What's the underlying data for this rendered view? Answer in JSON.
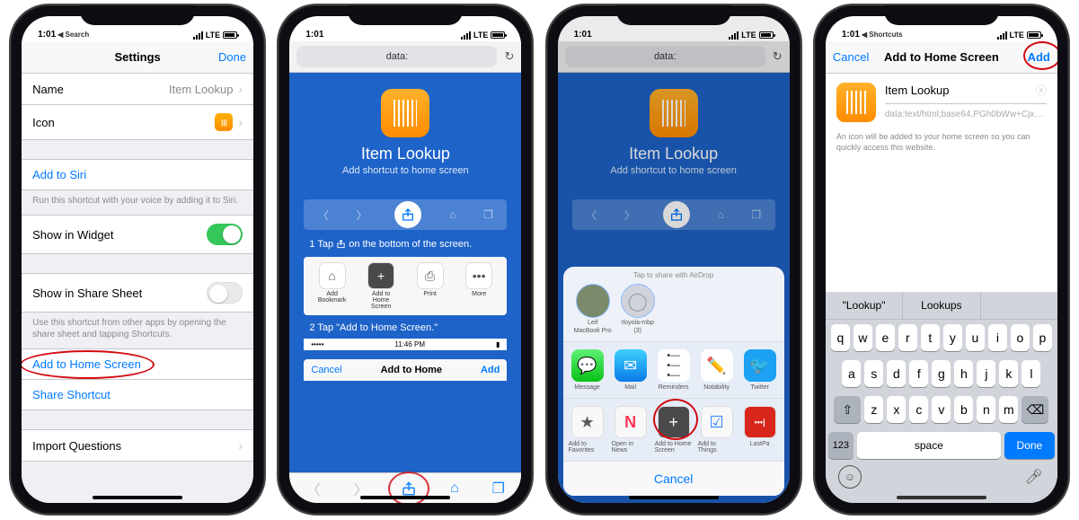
{
  "status": {
    "time": "1:01",
    "back_search": "Search",
    "back_shortcuts": "Shortcuts",
    "carrier": "LTE"
  },
  "p1": {
    "nav": {
      "title": "Settings",
      "done": "Done"
    },
    "name": {
      "label": "Name",
      "value": "Item Lookup"
    },
    "icon": {
      "label": "Icon"
    },
    "siri": {
      "label": "Add to Siri",
      "note": "Run this shortcut with your voice by adding it to Siri."
    },
    "widget": {
      "label": "Show in Widget"
    },
    "share_sheet": {
      "label": "Show in Share Sheet",
      "note": "Use this shortcut from other apps by opening the share sheet and tapping Shortcuts."
    },
    "add_home": {
      "label": "Add to Home Screen"
    },
    "share_shortcut": {
      "label": "Share Shortcut"
    },
    "import": {
      "label": "Import Questions"
    }
  },
  "p2": {
    "url": "data:",
    "title": "Item Lookup",
    "subtitle": "Add shortcut to home screen",
    "step1_pre": "1  Tap ",
    "step1_post": " on the bottom of the screen.",
    "step2": "2  Tap \"Add to Home Screen.\"",
    "share_preview": {
      "a": "Add Bookmark",
      "b": "Add to Home Screen",
      "c": "Print",
      "d": "More"
    },
    "mini_time": "11:46 PM",
    "mininav": {
      "cancel": "Cancel",
      "title": "Add to Home",
      "add": "Add"
    }
  },
  "p3": {
    "url": "data:",
    "title": "Item Lookup",
    "subtitle": "Add shortcut to home screen",
    "airdrop_hint": "Tap to share with AirDrop",
    "ad1": {
      "name": "Leif",
      "sub": "MacBook Pro"
    },
    "ad2": {
      "name": "rloyola-mbp",
      "sub": "(3)"
    },
    "apps": {
      "a": "Message",
      "b": "Mail",
      "c": "Reminders",
      "d": "Notability",
      "e": "Twitter"
    },
    "actions": {
      "a": "Add to Favorites",
      "b": "Open in News",
      "c": "Add to Home Screen",
      "d": "Add to Things",
      "e": "LastPa"
    },
    "cancel": "Cancel"
  },
  "p4": {
    "nav": {
      "cancel": "Cancel",
      "title": "Add to Home Screen",
      "add": "Add"
    },
    "name": "Item Lookup",
    "url": "data:text/html;base64,PGh0bWw+Cjx…",
    "note": "An icon will be added to your home screen so you can quickly access this website.",
    "suggest": {
      "a": "\"Lookup\"",
      "b": "Lookups",
      "c": ""
    },
    "keys": {
      "r1": [
        "q",
        "w",
        "e",
        "r",
        "t",
        "y",
        "u",
        "i",
        "o",
        "p"
      ],
      "r2": [
        "a",
        "s",
        "d",
        "f",
        "g",
        "h",
        "j",
        "k",
        "l"
      ],
      "r3": [
        "z",
        "x",
        "c",
        "v",
        "b",
        "n",
        "m"
      ],
      "num": "123",
      "space": "space",
      "done": "Done"
    }
  }
}
